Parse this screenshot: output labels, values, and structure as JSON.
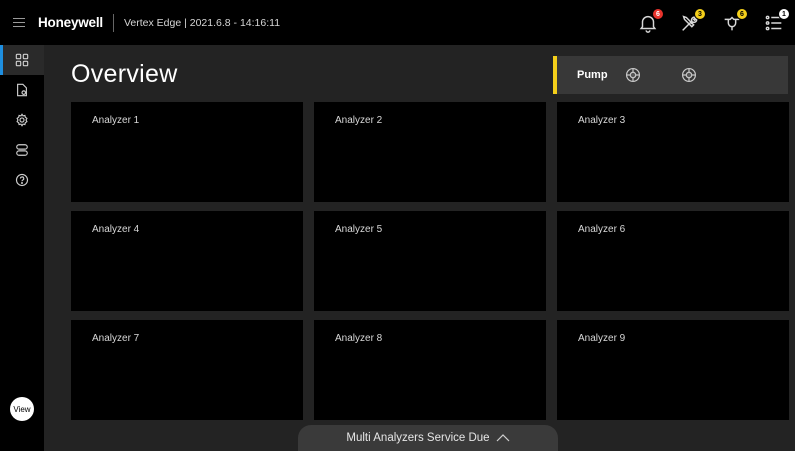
{
  "header": {
    "brand": "Honeywell",
    "subtitle": "Vertex Edge | 2021.6.8 - 14:16:11",
    "notifications": [
      {
        "icon": "bell-icon",
        "badge": "6",
        "badge_color": "#e8332c"
      },
      {
        "icon": "tools-icon",
        "badge": "3",
        "badge_color": "#f4cf1a"
      },
      {
        "icon": "maintenance-icon",
        "badge": "6",
        "badge_color": "#f4cf1a"
      },
      {
        "icon": "task-list-icon",
        "badge": "1",
        "badge_color": "#ffffff"
      }
    ]
  },
  "sidebar": {
    "items": [
      {
        "icon": "grid-icon",
        "active": true
      },
      {
        "icon": "report-icon"
      },
      {
        "icon": "gear-icon"
      },
      {
        "icon": "toggle-icon"
      },
      {
        "icon": "help-icon"
      }
    ],
    "view_label": "View",
    "accent": "#1e8fe0"
  },
  "main": {
    "title": "Overview",
    "pump": {
      "label": "Pump",
      "accent": "#f4cf1a",
      "icons": [
        "pump-icon",
        "pump-icon"
      ]
    },
    "analyzers": [
      {
        "label": "Analyzer 1"
      },
      {
        "label": "Analyzer 2"
      },
      {
        "label": "Analyzer 3"
      },
      {
        "label": "Analyzer 4"
      },
      {
        "label": "Analyzer 5"
      },
      {
        "label": "Analyzer 6"
      },
      {
        "label": "Analyzer 7"
      },
      {
        "label": "Analyzer 8"
      },
      {
        "label": "Analyzer 9"
      }
    ]
  },
  "footer": {
    "service_label": "Multi Analyzers Service Due",
    "service_icon": "chevron-up-icon"
  }
}
